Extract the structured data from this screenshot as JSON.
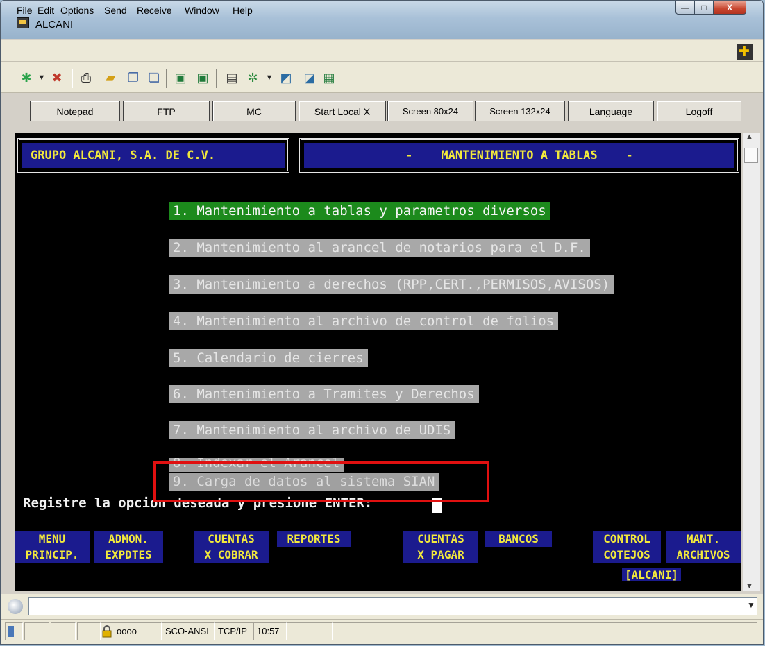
{
  "window": {
    "title": "ALCANI",
    "controls": {
      "minimize": "—",
      "maximize": "□",
      "close": "X"
    }
  },
  "menubar": {
    "items": [
      "File",
      "Edit",
      "Options",
      "Send",
      "Receive",
      "Window",
      "Help"
    ]
  },
  "toolbar": {
    "icons": [
      "new-session-icon",
      "dropdown-arrow-icon",
      "open-session-icon",
      "print-icon",
      "folder-icon",
      "copy-icon",
      "paste-icon",
      "keyboard-map-icon",
      "keyboard-map2-icon",
      "book-icon",
      "tools-icon",
      "dropdown-arrow-icon",
      "settings-icon",
      "properties-icon",
      "screen-icon"
    ]
  },
  "buttonbar": {
    "buttons": [
      "Notepad",
      "FTP",
      "MC",
      "Start Local X",
      "Screen 80x24",
      "Screen 132x24",
      "Language",
      "Logoff"
    ]
  },
  "terminal": {
    "company": "GRUPO ALCANI, S.A. DE C.V.",
    "screen_title": "-    MANTENIMIENTO A TABLAS    -",
    "menu": [
      "1. Mantenimiento a tablas y parametros diversos",
      "2. Mantenimiento al arancel de notarios para el D.F.",
      "3. Mantenimiento a derechos (RPP,CERT.,PERMISOS,AVISOS)",
      "4. Mantenimiento al archivo de control de folios",
      "5. Calendario de cierres",
      "6. Mantenimiento a Tramites y Derechos",
      "7. Mantenimiento al archivo de UDIS",
      "8. Indexar el Arancel",
      "9. Carga de datos al sistema SIAN"
    ],
    "prompt": "Registre la opcion deseada y presione ENTER:",
    "function_keys": [
      [
        "MENU",
        "PRINCIP."
      ],
      [
        "ADMON.",
        "EXPDTES"
      ],
      [
        "CUENTAS",
        "X COBRAR"
      ],
      [
        "REPORTES",
        ""
      ],
      [
        "CUENTAS",
        "X PAGAR"
      ],
      [
        "BANCOS",
        ""
      ],
      [
        "CONTROL",
        "COTEJOS"
      ],
      [
        "MANT.",
        "ARCHIVOS"
      ]
    ],
    "tag": "[ALCANI]"
  },
  "inputbar": {
    "value": ""
  },
  "statusbar": {
    "panels": [
      "oooo",
      "SCO-ANSI",
      "TCP/IP",
      "10:57"
    ]
  },
  "colors": {
    "selected_item": "#1c8a1c",
    "menu_item_bg": "#a8a8a8",
    "function_key_bg": "#1b1b8e",
    "function_key_text": "#f2e93c",
    "annotation_box": "#e01010"
  }
}
